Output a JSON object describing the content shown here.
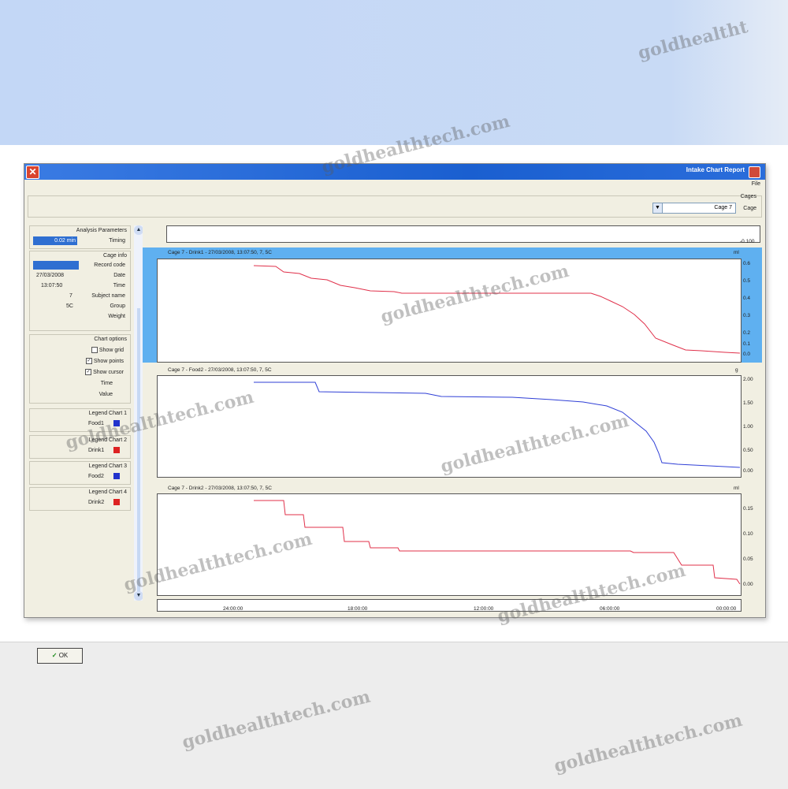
{
  "window": {
    "title": "Intake Chart Report",
    "menu": "File",
    "close_symbol": "✕"
  },
  "toolbar": {
    "cages_label": "Cages",
    "cage_label": "Cage",
    "cage_value": "Cage 7"
  },
  "left_panel": {
    "analysis": {
      "title": "Analysis Parameters",
      "timing_label": "Timing",
      "timing_value": "0.02 min"
    },
    "cage_info": {
      "title": "Cage info",
      "fields": [
        {
          "label": "Record code",
          "value": ""
        },
        {
          "label": "Date",
          "value": "27/03/2008"
        },
        {
          "label": "Time",
          "value": "13:07:50"
        },
        {
          "label": "Subject name",
          "value": "7"
        },
        {
          "label": "Group",
          "value": "5C"
        },
        {
          "label": "Weight",
          "value": ""
        }
      ]
    },
    "chart_options": {
      "title": "Chart options",
      "items": [
        {
          "label": "Show grid",
          "checked": false
        },
        {
          "label": "Show points",
          "checked": true
        },
        {
          "label": "Show cursor",
          "checked": true
        }
      ],
      "extra": [
        "Time",
        "Value"
      ]
    },
    "legends": [
      {
        "title": "Legend Chart 1",
        "name": "Food1",
        "color": "#2233cc"
      },
      {
        "title": "Legend Chart 2",
        "name": "Drink1",
        "color": "#dd2222"
      },
      {
        "title": "Legend Chart 3",
        "name": "Food2",
        "color": "#2233cc"
      },
      {
        "title": "Legend Chart 4",
        "name": "Drink2",
        "color": "#dd2222"
      }
    ],
    "ok_label": "OK"
  },
  "charts": {
    "top_strip": {
      "tick": "-0.100"
    },
    "panels": [
      {
        "header": "Cage 7 - Drink1 - 27/03/2008, 13:07:50, 7, 5C",
        "unit": "ml",
        "ticks": [
          "0.6",
          "0.5",
          "0.4",
          "0.3",
          "0.2",
          "0.1",
          "0.0"
        ],
        "color": "#e0304a"
      },
      {
        "header": "Cage 7 - Food2 - 27/03/2008, 13:07:50, 7, 5C",
        "unit": "g",
        "ticks": [
          "2.00",
          "1.50",
          "1.00",
          "0.50",
          "0.00"
        ],
        "color": "#2f3fd6"
      },
      {
        "header": "Cage 7 - Drink2 - 27/03/2008, 13:07:50, 7, 5C",
        "unit": "ml",
        "ticks": [
          "0.15",
          "0.10",
          "0.05",
          "0.00"
        ],
        "color": "#e0304a"
      }
    ],
    "time_axis": [
      "00:00:00",
      "06:00:00",
      "12:00:00",
      "18:00:00",
      "24:00:00"
    ]
  },
  "watermarks": [
    "goldhealtht",
    "goldhealthtech.com"
  ]
}
